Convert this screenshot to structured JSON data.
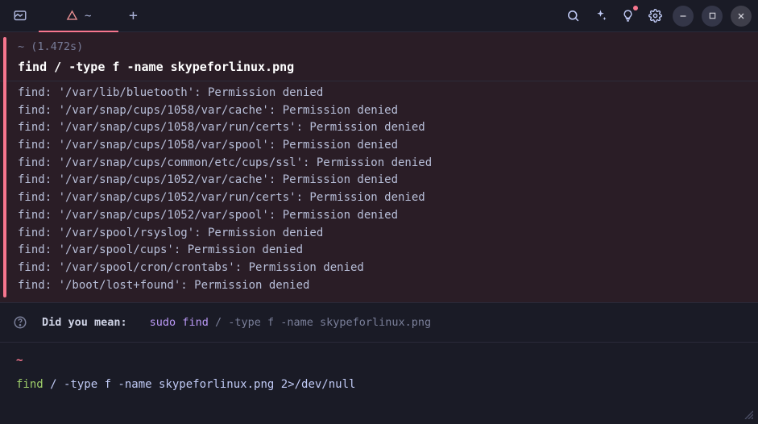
{
  "tabbar": {
    "active_tab_title": "~",
    "plus_label": "+"
  },
  "block": {
    "status": "~ (1.472s)",
    "command": "find / -type f -name skypeforlinux.png",
    "output": [
      "find: '/var/lib/bluetooth': Permission denied",
      "find: '/var/snap/cups/1058/var/cache': Permission denied",
      "find: '/var/snap/cups/1058/var/run/certs': Permission denied",
      "find: '/var/snap/cups/1058/var/spool': Permission denied",
      "find: '/var/snap/cups/common/etc/cups/ssl': Permission denied",
      "find: '/var/snap/cups/1052/var/cache': Permission denied",
      "find: '/var/snap/cups/1052/var/run/certs': Permission denied",
      "find: '/var/snap/cups/1052/var/spool': Permission denied",
      "find: '/var/spool/rsyslog': Permission denied",
      "find: '/var/spool/cups': Permission denied",
      "find: '/var/spool/cron/crontabs': Permission denied",
      "find: '/boot/lost+found': Permission denied"
    ]
  },
  "suggestion": {
    "label": "Did you mean:",
    "cmd": "sudo find",
    "args": " / -type f -name skypeforlinux.png"
  },
  "prompt": {
    "cwd": "~",
    "cmd": "find",
    "rest": " / -type f -name skypeforlinux.png 2>/dev/null"
  },
  "colors": {
    "accent": "#f7768e",
    "purple": "#bb9af7",
    "green": "#9ece6a"
  }
}
